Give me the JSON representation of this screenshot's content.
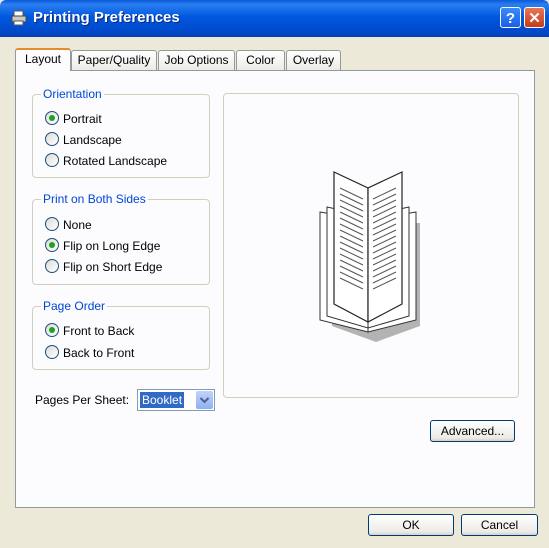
{
  "window": {
    "title": "Printing Preferences",
    "help_label": "?",
    "close_label": "✕"
  },
  "tabs": [
    {
      "label": "Layout"
    },
    {
      "label": "Paper/Quality"
    },
    {
      "label": "Job Options"
    },
    {
      "label": "Color"
    },
    {
      "label": "Overlay"
    }
  ],
  "orientation": {
    "title": "Orientation",
    "options": [
      {
        "label": "Portrait",
        "checked": true
      },
      {
        "label": "Landscape",
        "checked": false
      },
      {
        "label": "Rotated Landscape",
        "checked": false
      }
    ]
  },
  "print_both_sides": {
    "title": "Print on Both Sides",
    "options": [
      {
        "label": "None",
        "checked": false
      },
      {
        "label": "Flip on Long Edge",
        "checked": true
      },
      {
        "label": "Flip on Short Edge",
        "checked": false
      }
    ]
  },
  "page_order": {
    "title": "Page Order",
    "options": [
      {
        "label": "Front to Back",
        "checked": true
      },
      {
        "label": "Back to Front",
        "checked": false
      }
    ]
  },
  "pages_per_sheet": {
    "label": "Pages Per Sheet:",
    "value": "Booklet"
  },
  "buttons": {
    "advanced": "Advanced...",
    "ok": "OK",
    "cancel": "Cancel"
  },
  "icons": {
    "title_icon": "printer-icon",
    "preview": "booklet-preview-icon",
    "dropdown": "chevron-down-icon"
  }
}
